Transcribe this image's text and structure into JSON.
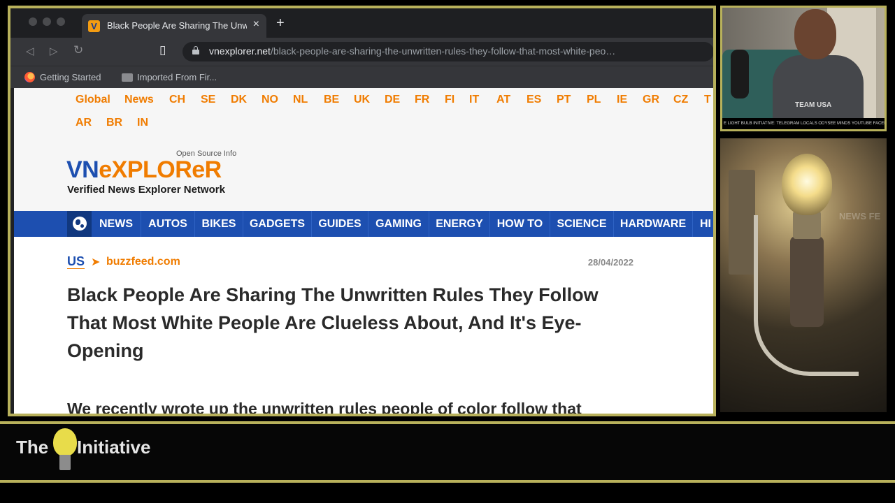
{
  "browser": {
    "tab_title": "Black People Are Sharing The Unwritten",
    "tab_favicon_letter": "V",
    "tab_close": "×",
    "new_tab": "+",
    "url_host": "vnexplorer.net",
    "url_path": "/black-people-are-sharing-the-unwritten-rules-they-follow-that-most-white-peo…",
    "bookmarks": [
      "Getting Started",
      "Imported From Fir..."
    ]
  },
  "site": {
    "regions_row1": [
      "Global",
      "News",
      "CH",
      "SE",
      "DK",
      "NO",
      "NL",
      "BE",
      "UK",
      "DE",
      "FR",
      "FI",
      "IT",
      "AT",
      "ES",
      "PT",
      "PL",
      "IE",
      "GR",
      "CZ",
      "T"
    ],
    "regions_row2": [
      "AR",
      "BR",
      "IN"
    ],
    "logo_tagline": "Open Source Info",
    "logo_vn": "VN",
    "logo_explorer": "eXPLOReR",
    "logo_subtitle": "Verified News Explorer Network",
    "categories": [
      "NEWS",
      "AUTOS",
      "BIKES",
      "GADGETS",
      "GUIDES",
      "GAMING",
      "ENERGY",
      "HOW TO",
      "SCIENCE",
      "HARDWARE",
      "HI"
    ]
  },
  "article": {
    "country": "US",
    "arrow": "➤",
    "source": "buzzfeed.com",
    "date": "28/04/2022",
    "headline": "Black People Are Sharing The Unwritten Rules They Follow That Most White People Are Clueless About, And It's Eye-Opening",
    "body_start": "We recently wrote up the unwritten rules people of color follow that"
  },
  "webcam": {
    "shirt_text": "TEAM USA",
    "ticker": "E LIGHT BULB INITIATIVE: TELEGRAM LOCALS ODYSEE MINDS YOUTUBE FACEB"
  },
  "bulb_scene": {
    "ghost_text": "NEWS   FE"
  },
  "banner": {
    "word_the": "The",
    "word_initiative": "Initiative"
  },
  "colors": {
    "frame_gold": "#b8b15b",
    "site_orange": "#f07c00",
    "site_blue": "#1d4fb0"
  }
}
